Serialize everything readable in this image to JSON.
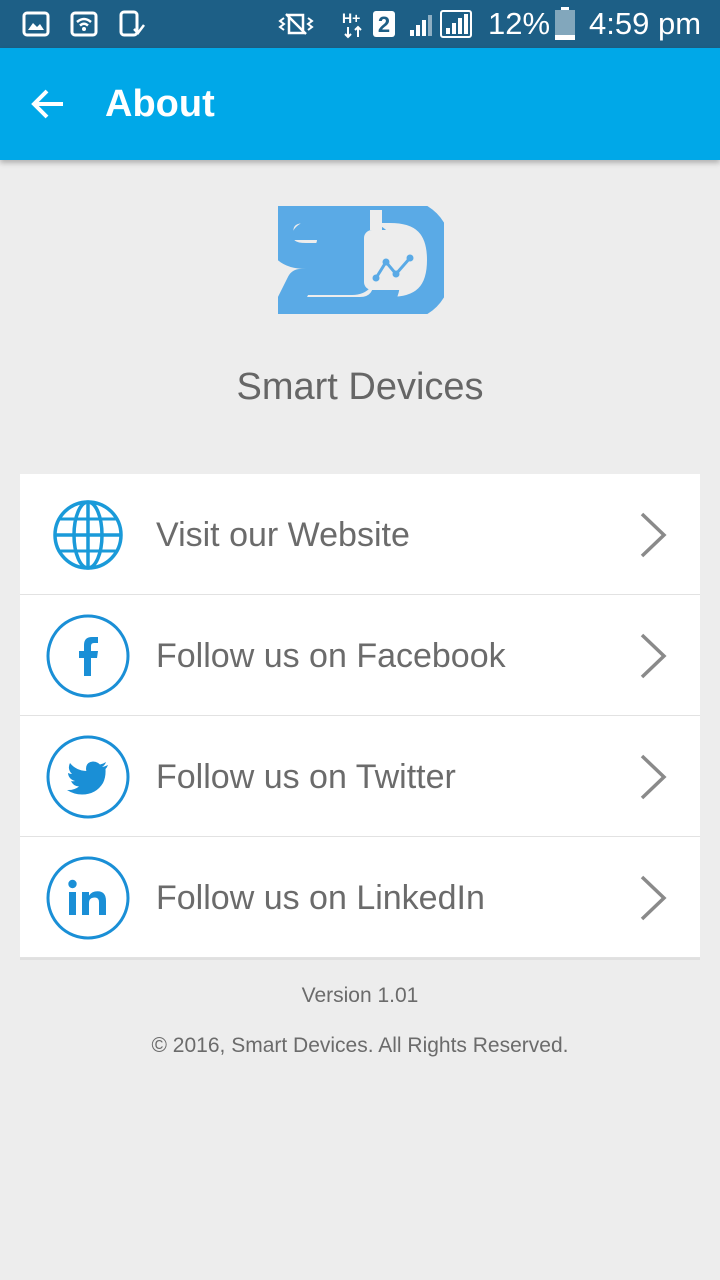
{
  "status_bar": {
    "battery_percent": "12%",
    "time": "4:59 pm",
    "sim_badge": "2",
    "icons": [
      "gallery-icon",
      "wifi-icon",
      "phone-check-icon",
      "vibrate-icon",
      "h-plus-data-icon",
      "signal-icon",
      "signal-icon",
      "battery-icon"
    ]
  },
  "app_bar": {
    "back_icon": "arrow-back-icon",
    "title": "About"
  },
  "brand": {
    "logo_icon": "smart-devices-logo",
    "name": "Smart Devices",
    "logo_color": "#5aaae6"
  },
  "links": [
    {
      "icon": "globe-icon",
      "label": "Visit our Website"
    },
    {
      "icon": "facebook-icon",
      "label": "Follow us on Facebook"
    },
    {
      "icon": "twitter-icon",
      "label": "Follow us on Twitter"
    },
    {
      "icon": "linkedin-icon",
      "label": "Follow us on LinkedIn"
    }
  ],
  "footer": {
    "version": "Version 1.01",
    "copyright": "© 2016, Smart Devices. All Rights Reserved."
  },
  "colors": {
    "app_bar": "#00a8e8",
    "status_bar": "#1d5f86",
    "accent_icon": "#1a8fd6",
    "background": "#ededed"
  }
}
